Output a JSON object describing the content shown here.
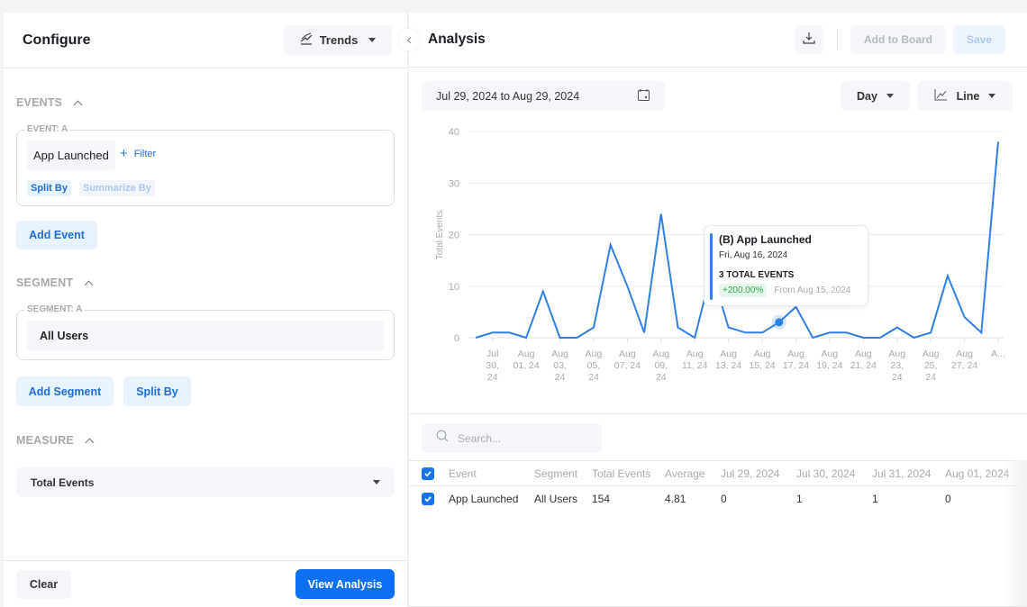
{
  "configure": {
    "title": "Configure",
    "type_selector": {
      "label": "Trends",
      "icon": "trends-icon"
    },
    "events_section": {
      "label": "EVENTS"
    },
    "event_a": {
      "legend": "EVENT: A",
      "event_name": "App Launched",
      "filter_label": "Filter",
      "split_by_label": "Split By",
      "summarize_by_label": "Summarize By"
    },
    "add_event_label": "Add Event",
    "segment_section": {
      "label": "SEGMENT"
    },
    "segment_a": {
      "legend": "SEGMENT: A",
      "value": "All Users"
    },
    "add_segment_label": "Add Segment",
    "split_by_label": "Split By",
    "measure_section": {
      "label": "MEASURE"
    },
    "measure_select": {
      "value": "Total Events"
    },
    "clear_label": "Clear",
    "view_analysis_label": "View Analysis"
  },
  "analysis": {
    "title": "Analysis",
    "download_icon": "download-icon",
    "add_to_board_label": "Add to Board",
    "save_label": "Save",
    "date_range": "Jul 29, 2024 to Aug 29, 2024",
    "interval": "Day",
    "chart_type": "Line",
    "search_placeholder": "Search...",
    "tooltip": {
      "title": "(B) App Launched",
      "date": "Fri, Aug 16, 2024",
      "total": "3 TOTAL EVENTS",
      "change": "+200.00%",
      "from": "From Aug 15, 2024"
    },
    "table": {
      "headers": [
        "Event",
        "Segment",
        "Total Events",
        "Average",
        "Jul 29, 2024",
        "Jul 30, 2024",
        "Jul 31, 2024",
        "Aug 01, 2024"
      ],
      "rows": [
        [
          "App Launched",
          "All Users",
          "154",
          "4.81",
          "0",
          "1",
          "1",
          "0"
        ]
      ]
    }
  },
  "colors": {
    "accent": "#0d6ff1",
    "line": "#2f80e6",
    "positive": "#2fa64f"
  },
  "chart_data": {
    "type": "line",
    "title": "",
    "xlabel": "",
    "ylabel": "Total Events",
    "ylim": [
      0,
      40
    ],
    "yticks": [
      0,
      10,
      20,
      30,
      40
    ],
    "grid": true,
    "series": [
      {
        "name": "App Launched",
        "values": [
          0,
          1,
          1,
          0,
          9,
          0,
          0,
          2,
          18,
          10,
          1,
          24,
          2,
          0,
          13,
          2,
          1,
          1,
          3,
          6,
          0,
          1,
          1,
          0,
          0,
          2,
          0,
          1,
          12,
          4,
          1,
          38
        ]
      }
    ],
    "x": [
      "Jul 29",
      "Jul 30",
      "Jul 31",
      "Aug 01",
      "Aug 02",
      "Aug 03",
      "Aug 04",
      "Aug 05",
      "Aug 06",
      "Aug 07",
      "Aug 08",
      "Aug 09",
      "Aug 10",
      "Aug 11",
      "Aug 12",
      "Aug 13",
      "Aug 14",
      "Aug 15",
      "Aug 16",
      "Aug 17",
      "Aug 18",
      "Aug 19",
      "Aug 20",
      "Aug 21",
      "Aug 22",
      "Aug 23",
      "Aug 24",
      "Aug 25",
      "Aug 26",
      "Aug 27",
      "Aug 28",
      "Aug 29"
    ],
    "tick_labels": [
      {
        "index": 1,
        "lines": [
          "Jul",
          "30,",
          "24"
        ]
      },
      {
        "index": 3,
        "lines": [
          "Aug",
          "01, 24"
        ]
      },
      {
        "index": 5,
        "lines": [
          "Aug",
          "03,",
          "24"
        ]
      },
      {
        "index": 7,
        "lines": [
          "Aug",
          "05,",
          "24"
        ]
      },
      {
        "index": 9,
        "lines": [
          "Aug",
          "07, 24"
        ]
      },
      {
        "index": 11,
        "lines": [
          "Aug",
          "09,",
          "24"
        ]
      },
      {
        "index": 13,
        "lines": [
          "Aug",
          "11, 24"
        ]
      },
      {
        "index": 15,
        "lines": [
          "Aug",
          "13, 24"
        ]
      },
      {
        "index": 17,
        "lines": [
          "Aug",
          "15, 24"
        ]
      },
      {
        "index": 19,
        "lines": [
          "Aug",
          "17, 24"
        ]
      },
      {
        "index": 21,
        "lines": [
          "Aug",
          "19, 24"
        ]
      },
      {
        "index": 23,
        "lines": [
          "Aug",
          "21, 24"
        ]
      },
      {
        "index": 25,
        "lines": [
          "Aug",
          "23,",
          "24"
        ]
      },
      {
        "index": 27,
        "lines": [
          "Aug",
          "25,",
          "24"
        ]
      },
      {
        "index": 29,
        "lines": [
          "Aug",
          "27, 24"
        ]
      },
      {
        "index": 31,
        "lines": [
          "A..."
        ]
      }
    ],
    "highlighted_index": 18
  }
}
